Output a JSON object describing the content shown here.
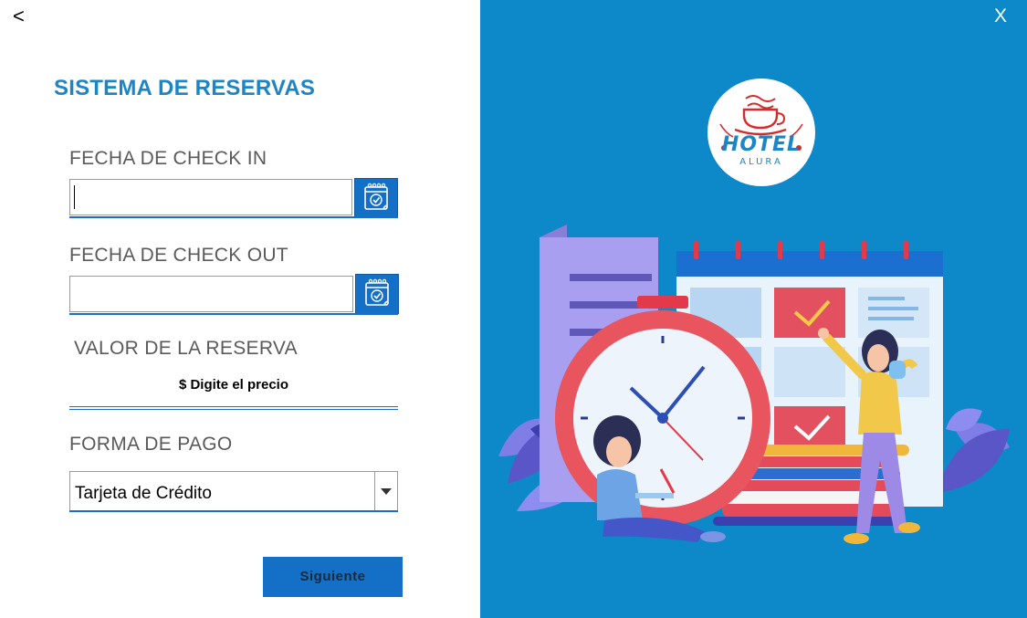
{
  "window": {
    "back_label": "<",
    "close_label": "X"
  },
  "form": {
    "title": "SISTEMA DE RESERVAS",
    "checkin": {
      "label": "FECHA DE CHECK IN",
      "value": ""
    },
    "checkout": {
      "label": "FECHA DE CHECK OUT",
      "value": ""
    },
    "valor": {
      "label": "VALOR DE LA RESERVA",
      "value": "$ Digite el precio"
    },
    "pago": {
      "label": "FORMA DE PAGO",
      "selected": "Tarjeta de Crédito"
    },
    "next_label": "Siguiente"
  },
  "logo": {
    "line1": "HOTEL",
    "line2": "ALURA"
  },
  "icons": {
    "calendar": "calendar-check-icon",
    "dropdown": "chevron-down-icon"
  },
  "colors": {
    "accent": "#1a86c8",
    "panel": "#0d89c9",
    "button": "#1470c6",
    "logo_red": "#d62b2b"
  }
}
